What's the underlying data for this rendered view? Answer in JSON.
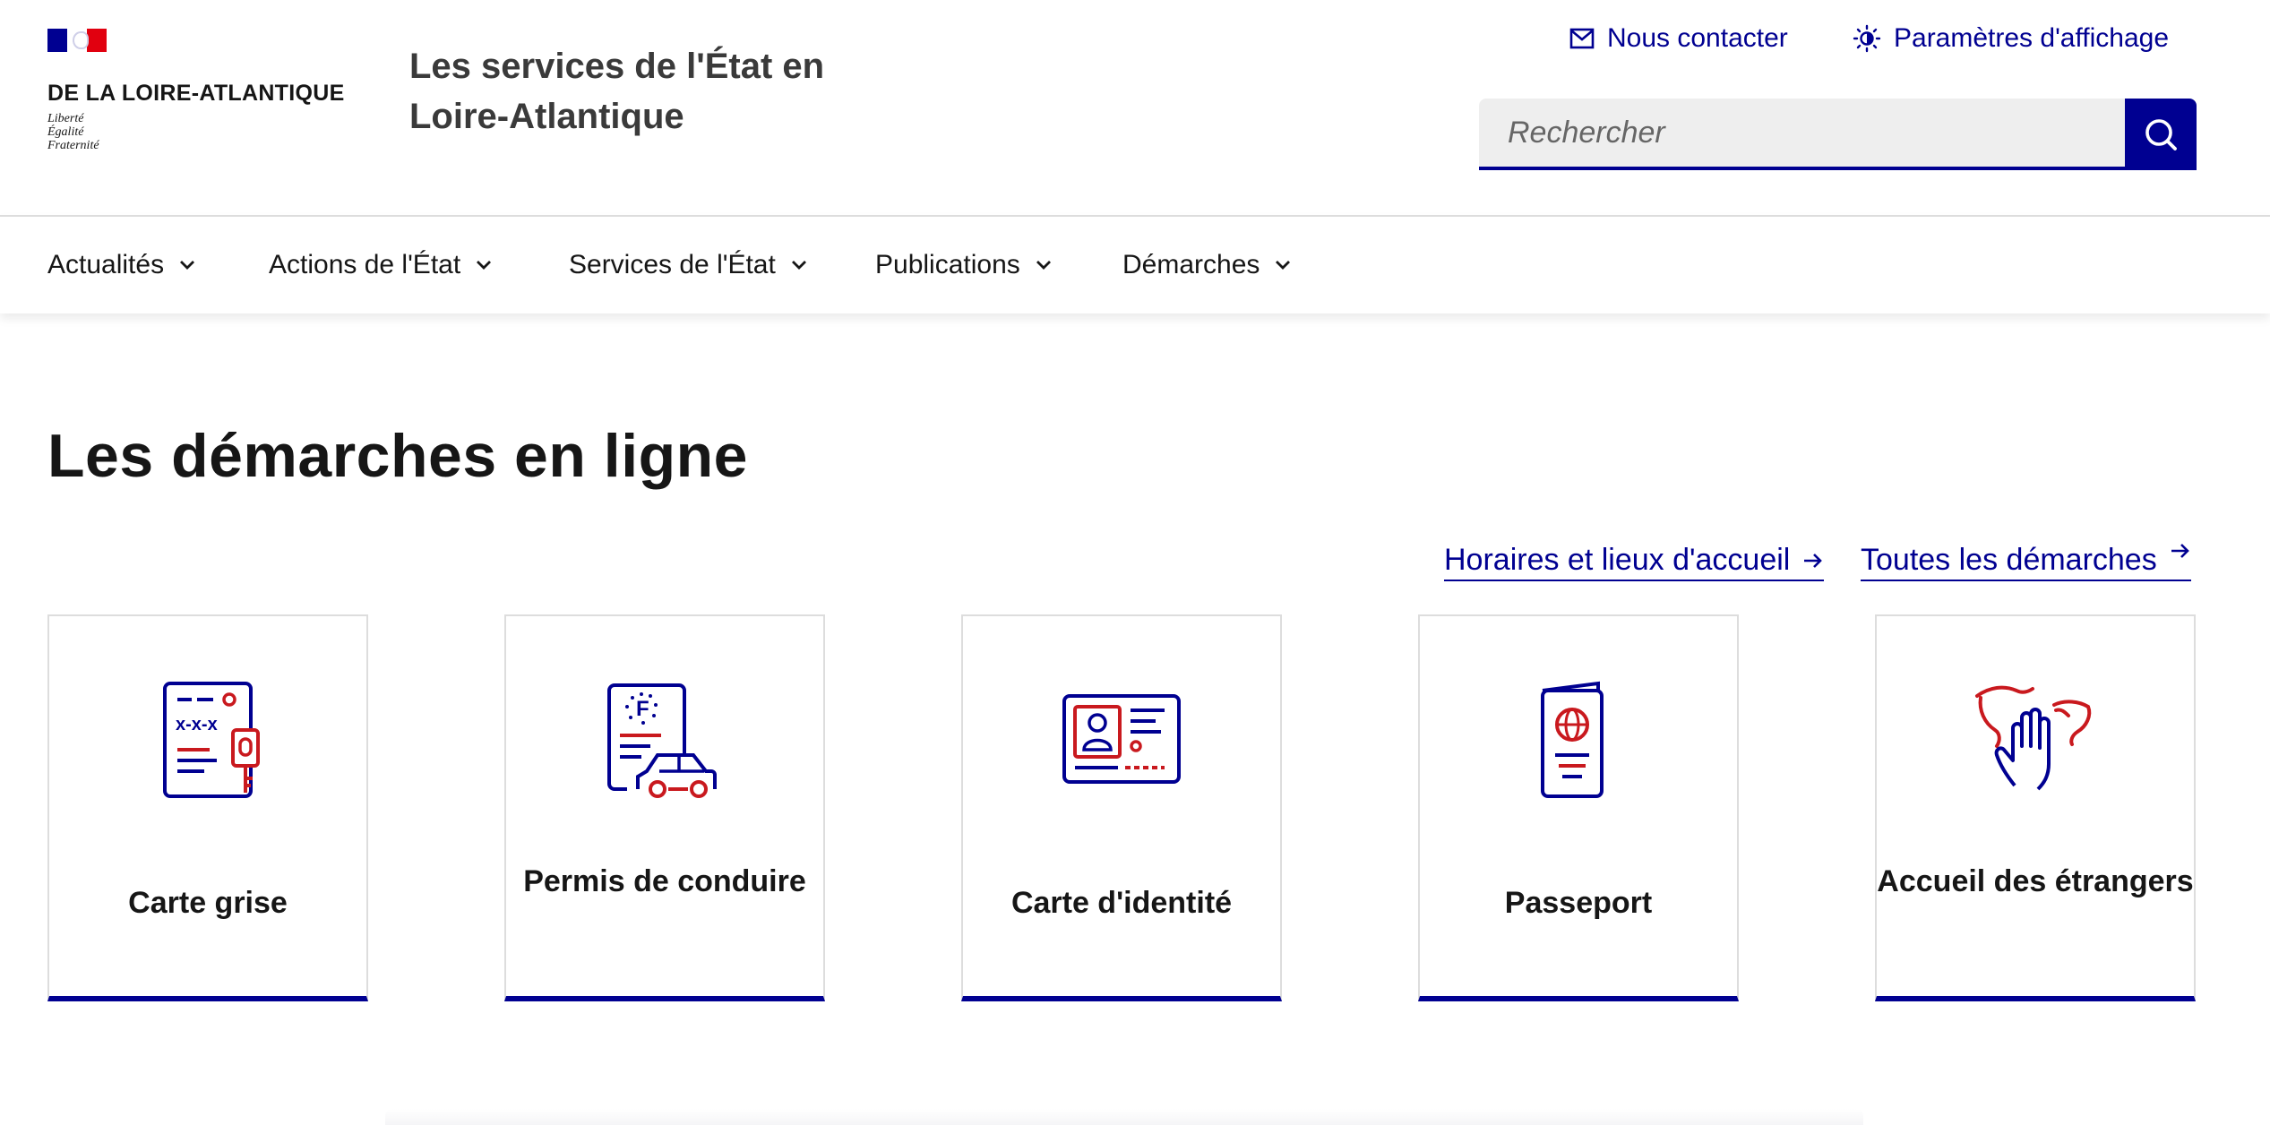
{
  "header": {
    "prefecture_name": "DE LA LOIRE-ATLANTIQUE",
    "devise": [
      "Liberté",
      "Égalité",
      "Fraternité"
    ],
    "service_title": "Les services de l'État en Loire-Atlantique",
    "tools": {
      "contact_label": "Nous contacter",
      "display_label": "Paramètres d'affichage"
    },
    "search": {
      "placeholder": "Rechercher"
    }
  },
  "nav": {
    "items": [
      {
        "label": "Actualités"
      },
      {
        "label": "Actions de l'État"
      },
      {
        "label": "Services de l'État"
      },
      {
        "label": "Publications"
      },
      {
        "label": "Démarches"
      }
    ]
  },
  "main": {
    "title": "Les démarches en ligne",
    "links": {
      "horaires": "Horaires et lieux d'accueil",
      "toutes": "Toutes les démarches"
    },
    "cards": [
      {
        "label": "Carte grise",
        "icon": "vehicle-registration-icon"
      },
      {
        "label": "Permis de conduire",
        "icon": "driving-licence-icon"
      },
      {
        "label": "Carte d'identité",
        "icon": "identity-card-icon"
      },
      {
        "label": "Passeport",
        "icon": "passport-icon"
      },
      {
        "label": "Accueil des étrangers",
        "icon": "foreigners-welcome-icon"
      }
    ]
  },
  "colors": {
    "blue_france": "#000091",
    "red_marianne": "#e1000f",
    "pictogram_red": "#c9191e",
    "text": "#161616",
    "border": "#dddddd",
    "search_bg": "#eeeeee"
  }
}
